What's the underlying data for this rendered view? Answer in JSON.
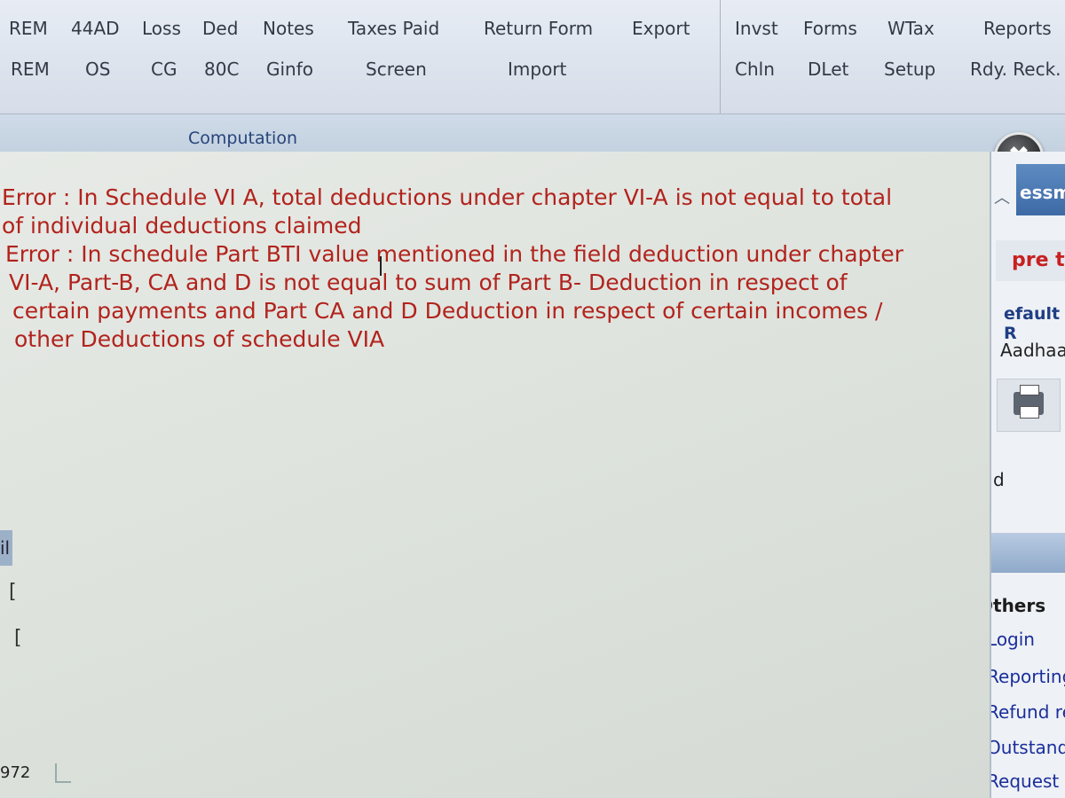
{
  "toolbar": {
    "row1": [
      "REM",
      "44AD",
      "Loss",
      "Ded",
      "Notes",
      "Taxes Paid",
      "Return Form",
      "Export",
      "Invst",
      "Forms",
      "WTax",
      "Reports"
    ],
    "row2": [
      "REM",
      "OS",
      "CG",
      "80C",
      "Ginfo",
      "Screen",
      "Import",
      "Chln",
      "DLet",
      "Setup",
      "Rdy. Reck."
    ]
  },
  "tabs": {
    "computation": "Computation"
  },
  "errors": {
    "error1_line1": "Error : In Schedule VI A, total deductions under chapter VI-A is not equal to total",
    "error1_line2": "of individual deductions claimed",
    "error2_line1": "Error : In schedule Part BTI value mentioned in the field deduction under chapter",
    "error2_line2": "VI-A, Part-B, CA and D is not equal to sum of Part B- Deduction in respect of",
    "error2_line3": "certain payments and Part CA and D Deduction in respect of certain incomes /",
    "error2_line4": "other Deductions of schedule VIA"
  },
  "close_button": {
    "label": "✖"
  },
  "sidebar": {
    "header": "essm",
    "red_link": "pre th",
    "default_label": "efault R",
    "aadhaar_label": "Aadhaa",
    "d_fragment": "d",
    "others_heading": "Others",
    "items": [
      "Login",
      "Reporting",
      "Refund re",
      "Outstandi",
      "Request fo"
    ]
  },
  "left_fragments": {
    "tab": "il",
    "code": "972"
  }
}
